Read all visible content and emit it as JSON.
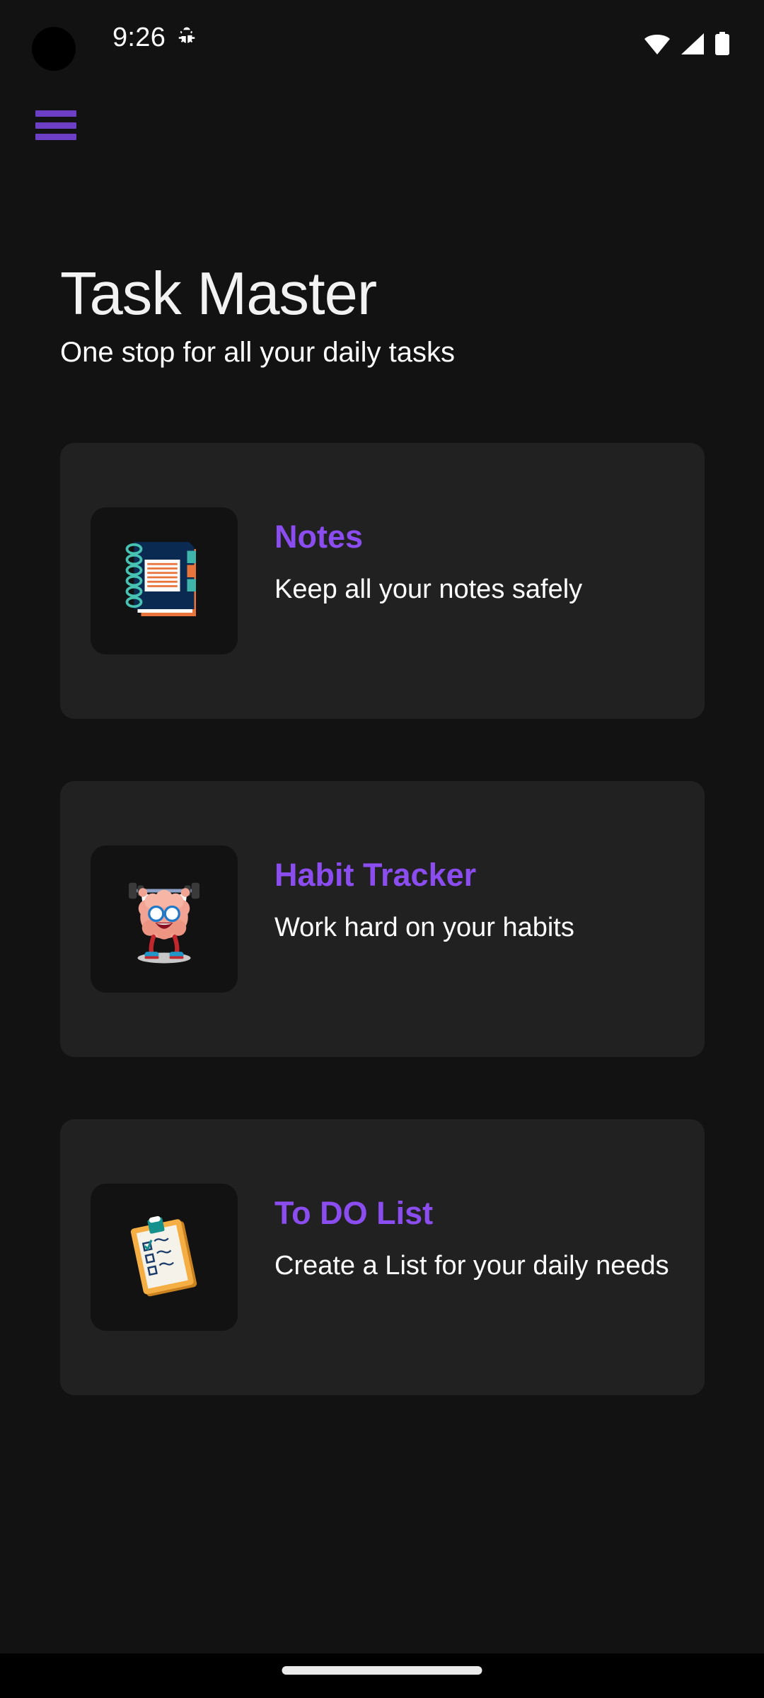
{
  "status_bar": {
    "time": "9:26",
    "debug_icon": "bug-icon",
    "wifi_icon": "wifi-icon",
    "signal_icon": "cellular-signal-icon",
    "battery_icon": "battery-full-icon",
    "camera_cutout": "front-camera-cutout"
  },
  "app_bar": {
    "menu_label": "menu",
    "menu_color": "#6C3FC4"
  },
  "header": {
    "title": "Task Master",
    "subtitle": "One stop for all your daily tasks"
  },
  "theme": {
    "background": "#121212",
    "card_background": "#212121",
    "icon_tile_background": "#121212",
    "accent_purple": "#8B4DF0",
    "menu_purple": "#6C3FC4",
    "text_primary": "#FFFFFF",
    "nav_bar_background": "#000000",
    "gesture_pill": "#EBEBEB"
  },
  "cards": [
    {
      "title": "Notes",
      "description": "Keep all your notes safely",
      "icon": "notebook-icon"
    },
    {
      "title": "Habit Tracker",
      "description": "Work hard on your habits",
      "icon": "brain-weightlifting-icon"
    },
    {
      "title": "To DO List",
      "description": "Create a List for your daily needs",
      "icon": "clipboard-checklist-icon"
    }
  ],
  "nav_bar": {
    "gesture_handle": "home-gesture-handle"
  }
}
